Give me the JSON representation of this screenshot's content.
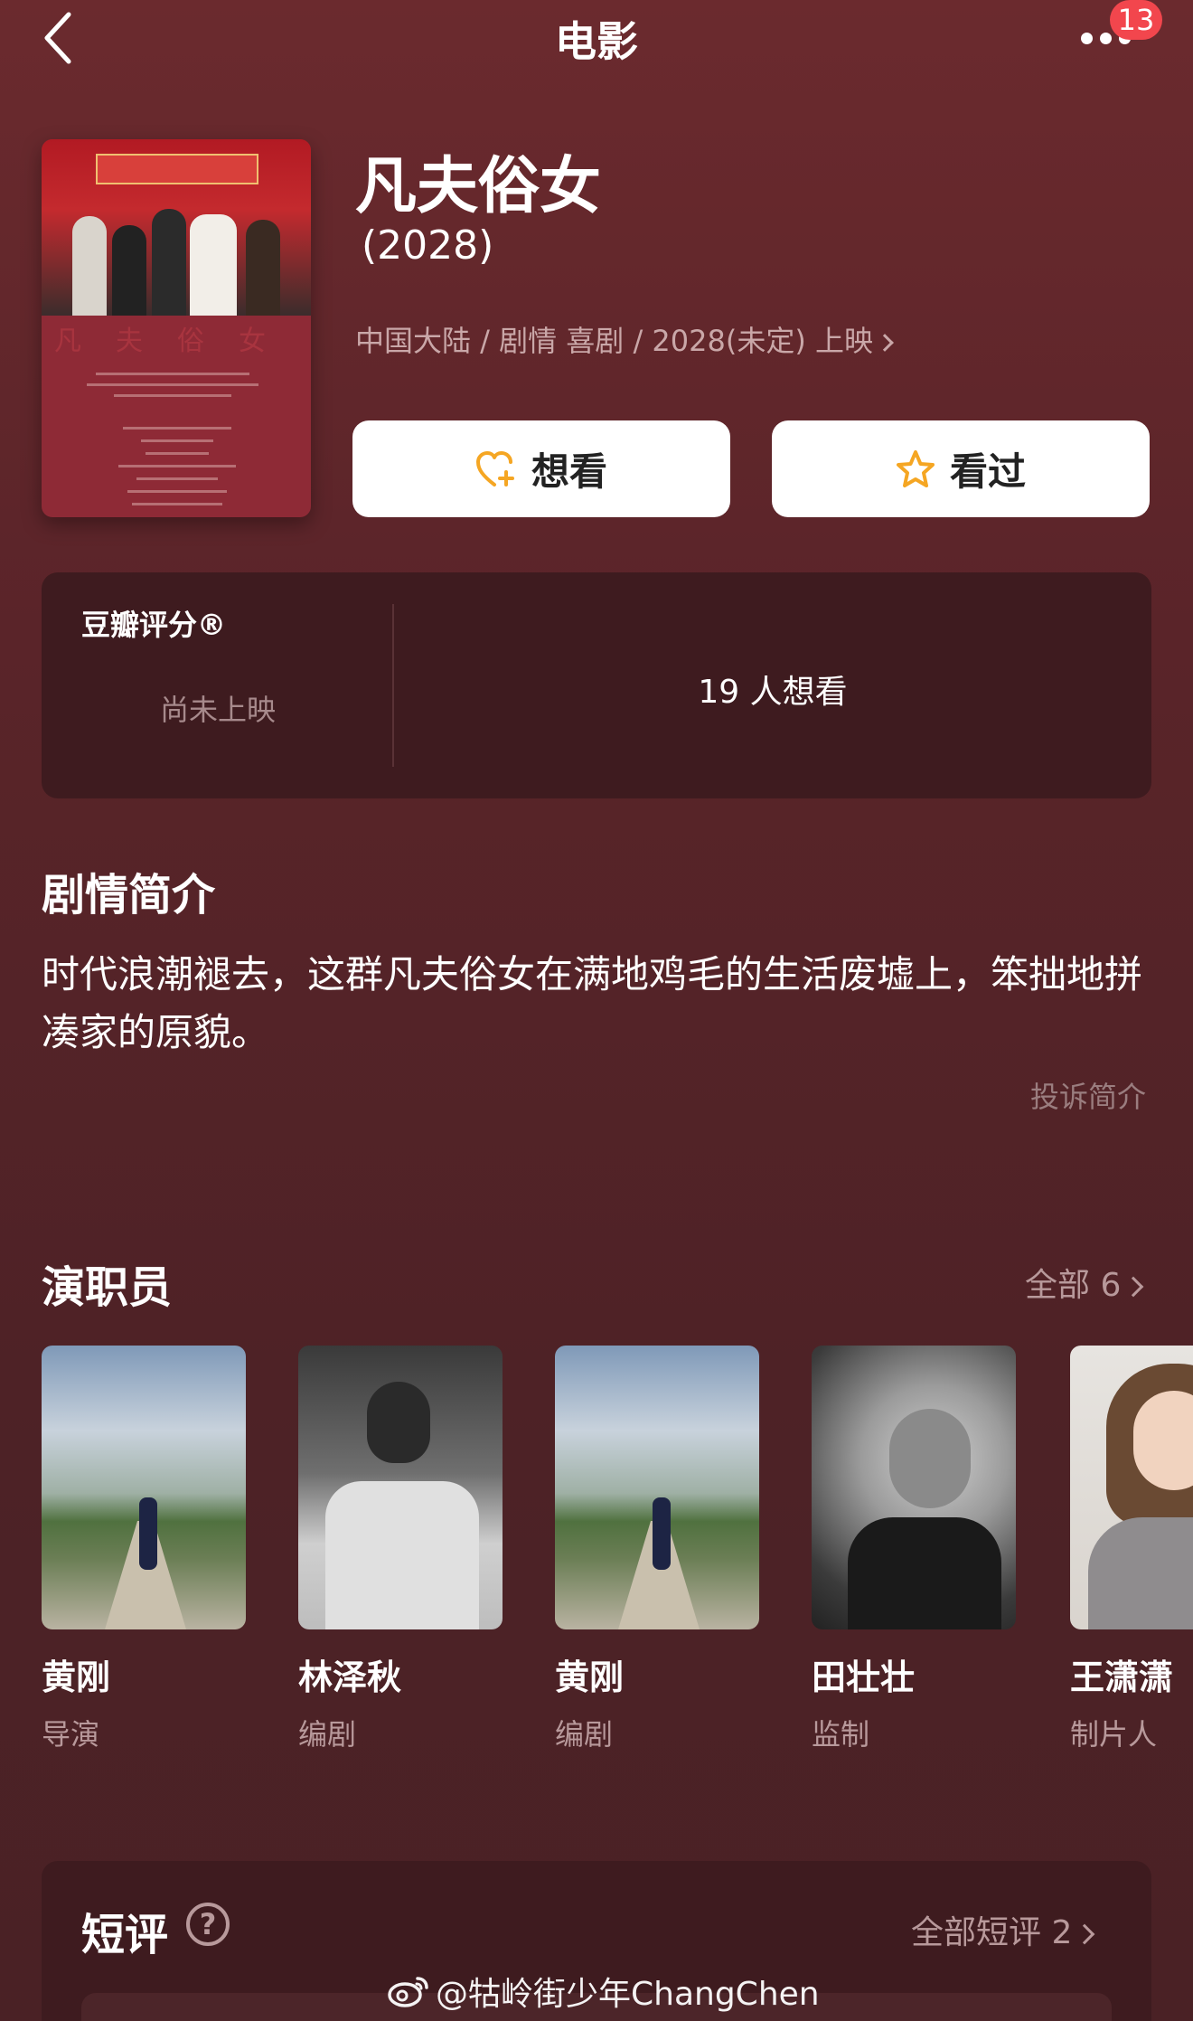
{
  "header": {
    "title": "电影",
    "notification_count": "13"
  },
  "movie": {
    "title": "凡夫俗女",
    "year": "(2028)",
    "meta": "中国大陆 / 剧情 喜剧 / 2028(未定) 上映",
    "poster_text": "凡　夫　俗　女"
  },
  "actions": {
    "want_label": "想看",
    "seen_label": "看过"
  },
  "rating": {
    "label": "豆瓣评分®",
    "status": "尚未上映",
    "want_count": "19 人想看"
  },
  "synopsis": {
    "title": "剧情简介",
    "text": "时代浪潮褪去，这群凡夫俗女在满地鸡毛的生活废墟上，笨拙地拼凑家的原貌。",
    "report_link": "投诉简介"
  },
  "cast": {
    "title": "演职员",
    "all_label": "全部 6",
    "members": [
      {
        "name": "黄刚",
        "role": "导演"
      },
      {
        "name": "林泽秋",
        "role": "编剧"
      },
      {
        "name": "黄刚",
        "role": "编剧"
      },
      {
        "name": "田壮壮",
        "role": "监制"
      },
      {
        "name": "王潇潇",
        "role": "制片人"
      }
    ]
  },
  "reviews": {
    "title": "短评",
    "all_label": "全部短评 2"
  },
  "watermark": "@牯岭街少年ChangChen",
  "colors": {
    "background": "#5a2429",
    "card": "#3e1b1f",
    "badge": "#f2464d",
    "star": "#f5a623"
  }
}
